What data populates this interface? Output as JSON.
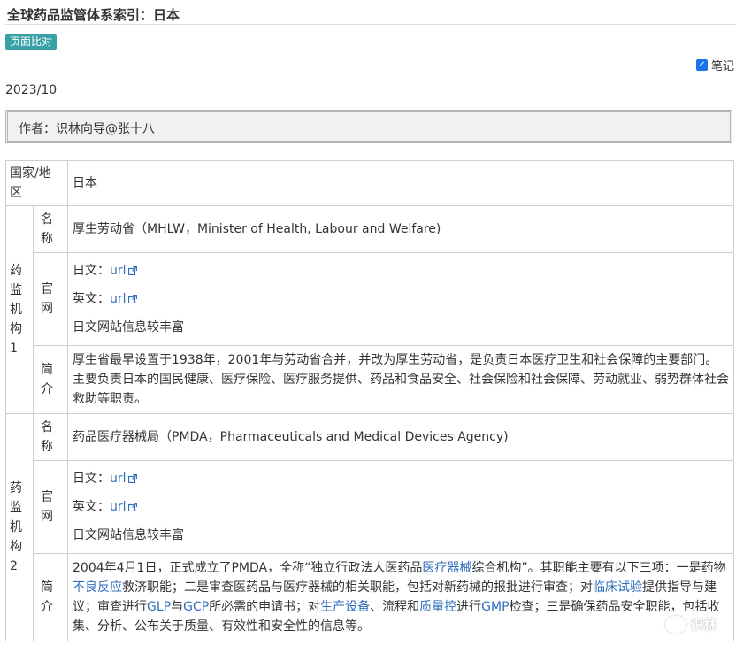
{
  "page": {
    "title": "全球药品监管体系索引：日本"
  },
  "toolbar": {
    "compare_label": "页面比对",
    "note_label": "笔记",
    "note_checked": true
  },
  "meta": {
    "date": "2023/10",
    "author": "作者：识林向导@张十八"
  },
  "table": {
    "header": {
      "label": "国家/地区",
      "value": "日本"
    },
    "groups": [
      {
        "label": "药监机构1",
        "name_label": "名称",
        "name": "厚生劳动省（MHLW，Minister of Health, Labour and Welfare)",
        "site_label": "官网",
        "site_ja_label": "日文：",
        "site_ja_link": "url",
        "site_en_label": "英文：",
        "site_en_link": "url",
        "site_note": "日文网站信息较丰富",
        "intro_label": "简介",
        "intro": "厚生省最早设置于1938年，2001年与劳动省合并，并改为厚生劳动省，是负责日本医疗卫生和社会保障的主要部门。主要负责日本的国民健康、医疗保险、医疗服务提供、药品和食品安全、社会保险和社会保障、劳动就业、弱势群体社会救助等职责。"
      },
      {
        "label": "药监机构2",
        "name_label": "名称",
        "name": "药品医疗器械局（PMDA，Pharmaceuticals and Medical Devices Agency)",
        "site_label": "官网",
        "site_ja_label": "日文：",
        "site_ja_link": "url",
        "site_en_label": "英文：",
        "site_en_link": "url",
        "site_note": "日文网站信息较丰富",
        "intro_label": "简介",
        "intro_parts": [
          "2004年4月1日，正式成立了PMDA，全称“独立行政法人医药品",
          "医疗器械",
          "综合机构”。其职能主要有以下三项：一是药物",
          "不良反应",
          "救济职能；二是审查医药品与医疗器械的相关职能，包括对新药械的报批进行审查；对",
          "临床试验",
          "提供指导与建议；审查进行",
          "GLP",
          "与",
          "GCP",
          "所必需的申请书；对",
          "生产设备",
          "、流程和",
          "质量控",
          "进行",
          "GMP",
          "检查；三是确保药品安全职能，包括收集、分析、公布关于质量、有效性和安全性的信息等。"
        ]
      }
    ]
  },
  "watermark": {
    "text": "识林"
  },
  "colors": {
    "accent": "#3aa0a7",
    "link": "#2f6fbd",
    "checkbox": "#1a73e8"
  }
}
